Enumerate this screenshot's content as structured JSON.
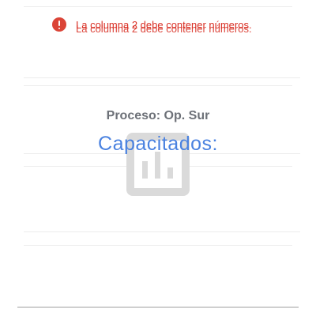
{
  "error": {
    "message": "La columna 2 debe contener números.",
    "icon": "error-icon",
    "color": "#d93025"
  },
  "widget": {
    "process_label": "Proceso: Op. Sur",
    "title": "Capacitados:",
    "title_color": "#4a82e0",
    "placeholder_icon": "bar-chart-icon"
  }
}
